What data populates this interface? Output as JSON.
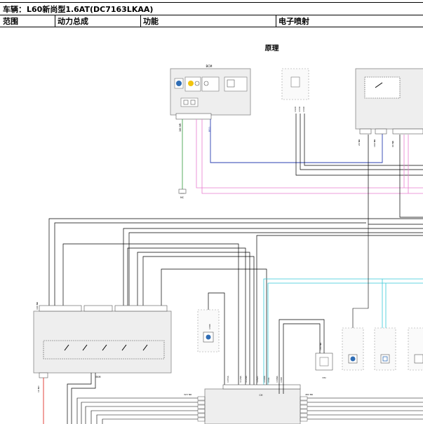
{
  "header": {
    "vehicle_label": "车辆：",
    "vehicle_value": "L60新尚型1.6AT(DC7163LKAA)",
    "scope_label": "范围",
    "scope_value": "动力总成",
    "function_label": "功能",
    "function_value": "电子喷射"
  },
  "diagram": {
    "title": "原理",
    "modules": {
      "top_left": "BCM",
      "bsm": "BSM",
      "ch": "CH",
      "dsi": "DSI"
    },
    "connectors": {
      "left_pin": "16V NR",
      "bcm_conn_a": "16V NR",
      "bcm_conn_b": "BSI1",
      "ground": "MC",
      "bsm_out": "1V NO",
      "ch_left_header": "32V NR",
      "ch_right_header": "48V BR",
      "dsi_conn": "16V NR",
      "ecu_conn_a": "2V NR",
      "ecu_conn_b": "16V NR",
      "ecu_conn_c": "6V NR"
    },
    "wire_codes": {
      "c1": "1320",
      "c2": "1330",
      "c3": "1340",
      "c4": "1355A",
      "c5": "1129A",
      "c6": "1120A",
      "c7": "1262C",
      "c8": "1500X",
      "c9": "1501",
      "c10": "1308A",
      "c11": "1390",
      "c12": "1304"
    }
  }
}
